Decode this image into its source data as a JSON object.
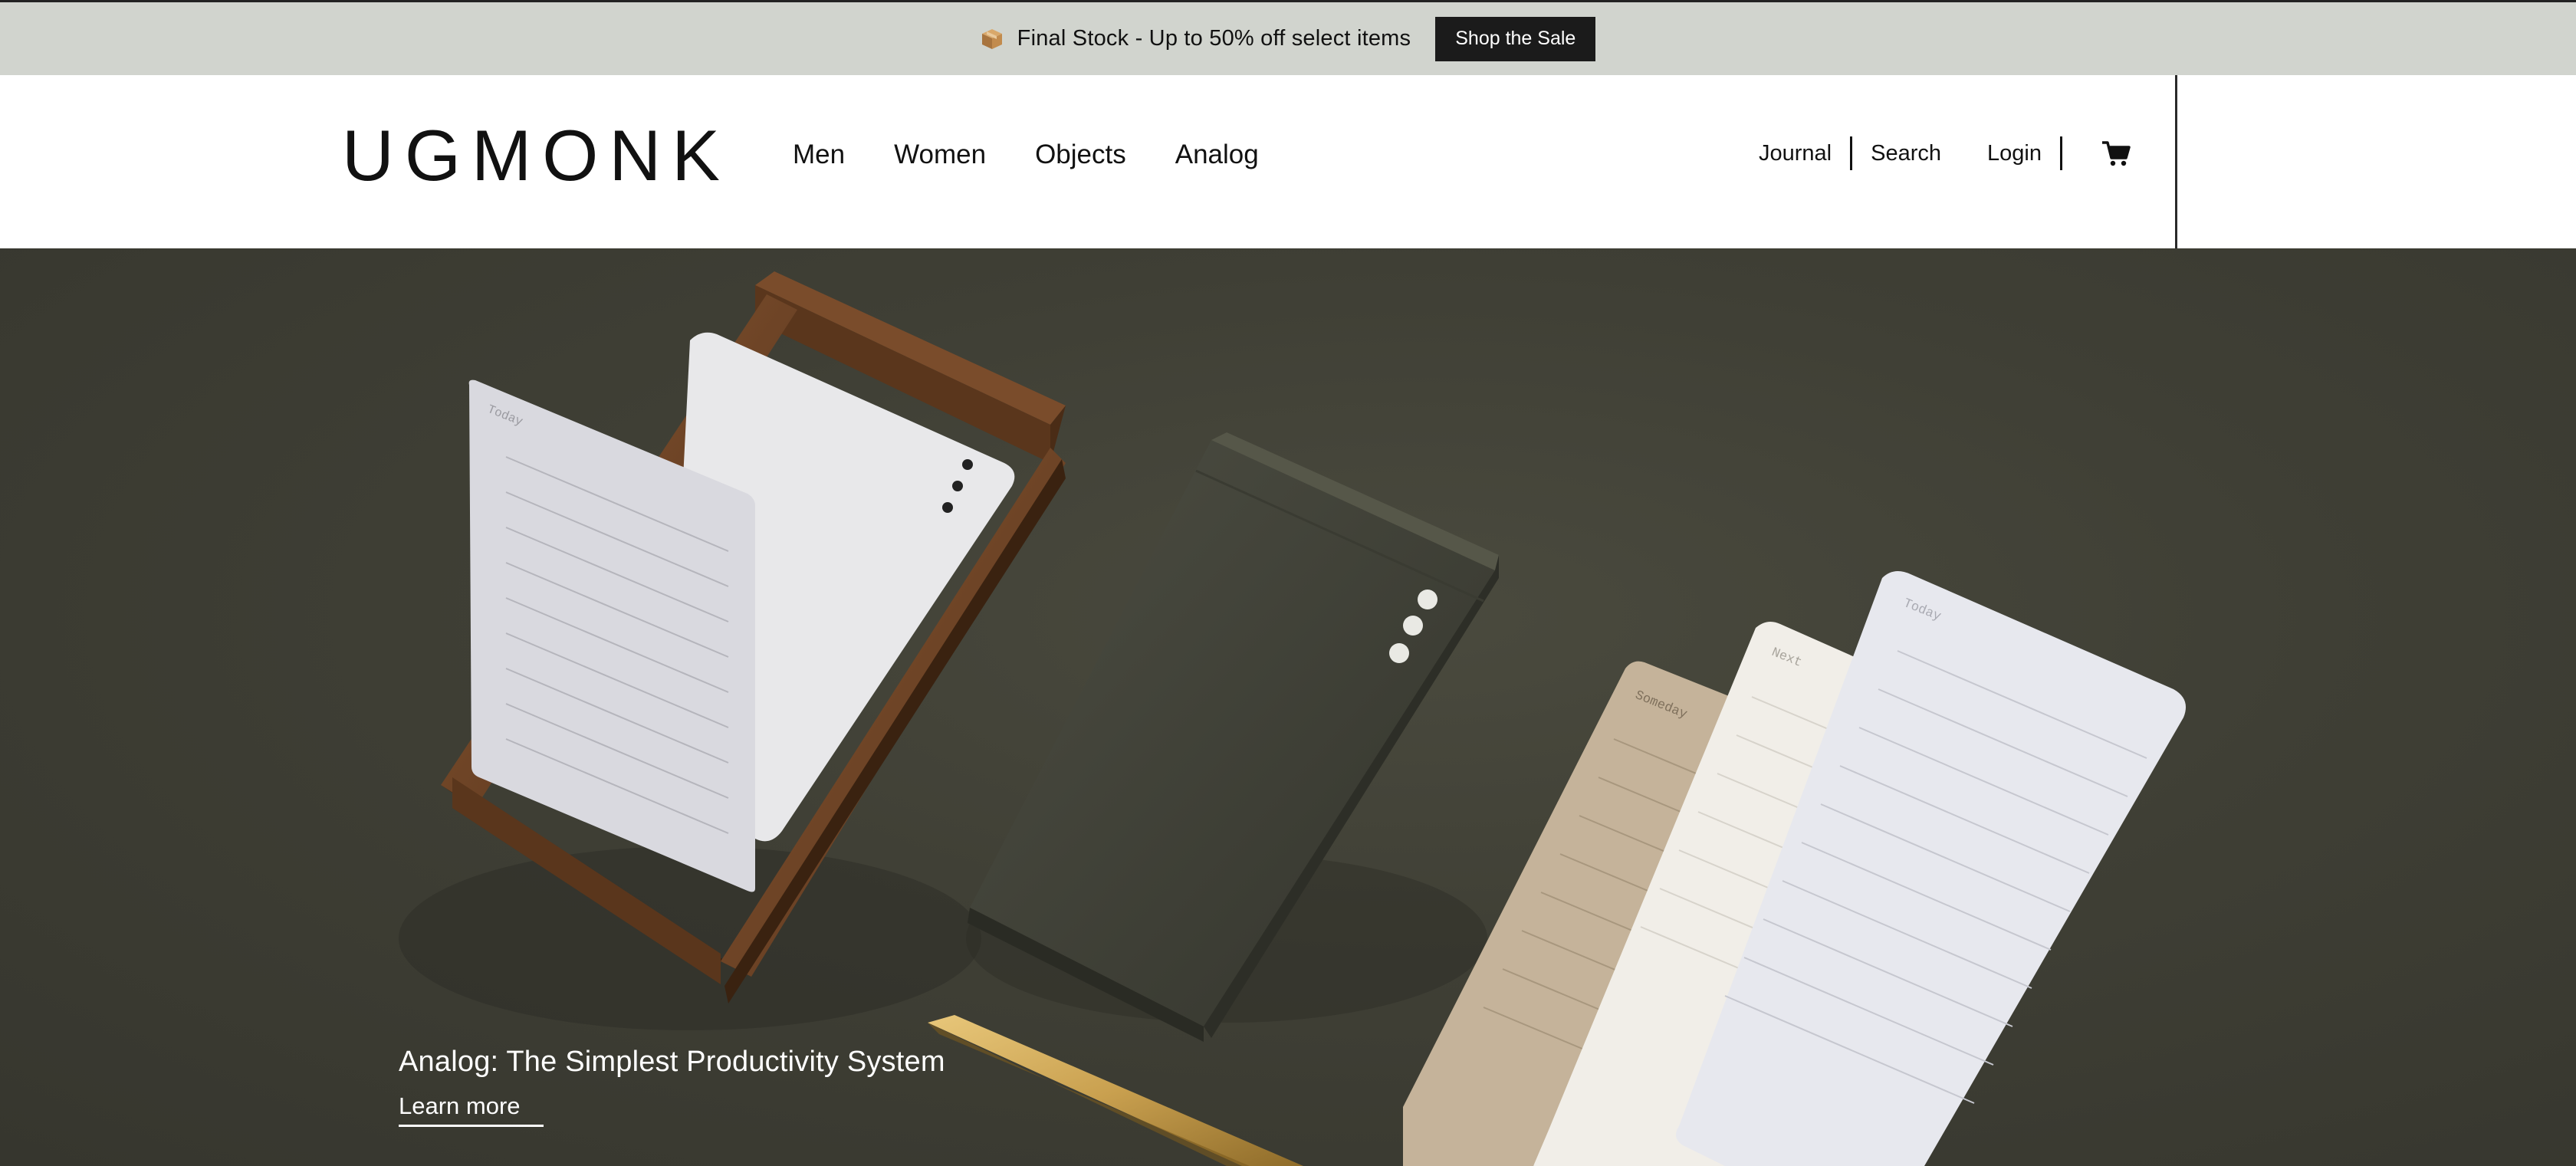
{
  "announcement": {
    "icon": "box-icon",
    "message": "Final Stock - Up to 50% off select items",
    "button_label": "Shop the Sale"
  },
  "header": {
    "logo": "UGMONK",
    "nav": [
      "Men",
      "Women",
      "Objects",
      "Analog"
    ],
    "utility": {
      "journal": "Journal",
      "search": "Search",
      "login": "Login",
      "cart_icon": "cart-icon"
    }
  },
  "hero": {
    "card_labels": {
      "today": "Today",
      "next": "Next",
      "someday": "Someday"
    },
    "title": "Analog: The Simplest Productivity System",
    "link_label": "Learn more"
  },
  "colors": {
    "announcement_bg": "#d1d4ce",
    "button_bg": "#1b1b1b",
    "hero_bg": "#3f3f35"
  }
}
